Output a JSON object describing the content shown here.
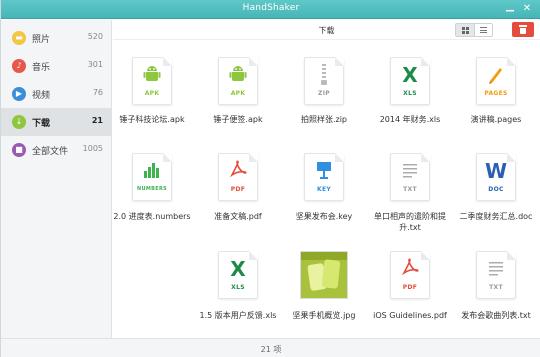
{
  "window": {
    "title": "HandShaker"
  },
  "sidebar": {
    "items": [
      {
        "label": "照片",
        "count": "520",
        "icon": "photo-icon",
        "color": "#f2c744"
      },
      {
        "label": "音乐",
        "count": "301",
        "icon": "music-icon",
        "color": "#e8584a"
      },
      {
        "label": "视频",
        "count": "76",
        "icon": "video-icon",
        "color": "#3b8fd8"
      },
      {
        "label": "下载",
        "count": "21",
        "icon": "download-icon",
        "color": "#8ec63f",
        "active": true
      },
      {
        "label": "全部文件",
        "count": "1005",
        "icon": "all-files-icon",
        "color": "#9b59b6"
      }
    ]
  },
  "main": {
    "title": "下载",
    "view_mode": "grid",
    "files": [
      {
        "name": "锤子科技论坛.apk",
        "type": "APK",
        "symbol": "android",
        "color": "#8ec63f"
      },
      {
        "name": "锤子便签.apk",
        "type": "APK",
        "symbol": "android",
        "color": "#8ec63f"
      },
      {
        "name": "拍照样张.zip",
        "type": "ZIP",
        "symbol": "zip",
        "color": "#999999"
      },
      {
        "name": "2014 年财务.xls",
        "type": "XLS",
        "symbol": "X",
        "color": "#1e8a4a"
      },
      {
        "name": "演讲稿.pages",
        "type": "PAGES",
        "symbol": "pen",
        "color": "#f39c12"
      },
      {
        "name": "2.0 进度表.numbers",
        "type": "NUMBERS",
        "symbol": "bars",
        "color": "#3fb34f"
      },
      {
        "name": "准备文稿.pdf",
        "type": "PDF",
        "symbol": "pdf",
        "color": "#e64c3c"
      },
      {
        "name": "坚果发布会.key",
        "type": "KEY",
        "symbol": "key",
        "color": "#2f8fe0"
      },
      {
        "name": "单口相声的遣阶和提升.txt",
        "type": "TXT",
        "symbol": "lines",
        "color": "#999999"
      },
      {
        "name": "二季度财务汇总.doc",
        "type": "DOC",
        "symbol": "W",
        "color": "#2b5fb4"
      },
      {
        "name": "1.5 版本用户反馈.xls",
        "type": "XLS",
        "symbol": "X",
        "color": "#1e8a4a"
      },
      {
        "name": "坚果手机概览.jpg",
        "type": "",
        "symbol": "photo",
        "color": "#a9c23d"
      },
      {
        "name": "iOS Guidelines.pdf",
        "type": "PDF",
        "symbol": "pdf",
        "color": "#e64c3c"
      },
      {
        "name": "发布会歌曲列表.txt",
        "type": "TXT",
        "symbol": "lines",
        "color": "#999999"
      }
    ]
  },
  "status": {
    "text": "21 项"
  },
  "colors": {
    "titlebar": "#4fbcbe",
    "delete": "#e64c3c"
  }
}
